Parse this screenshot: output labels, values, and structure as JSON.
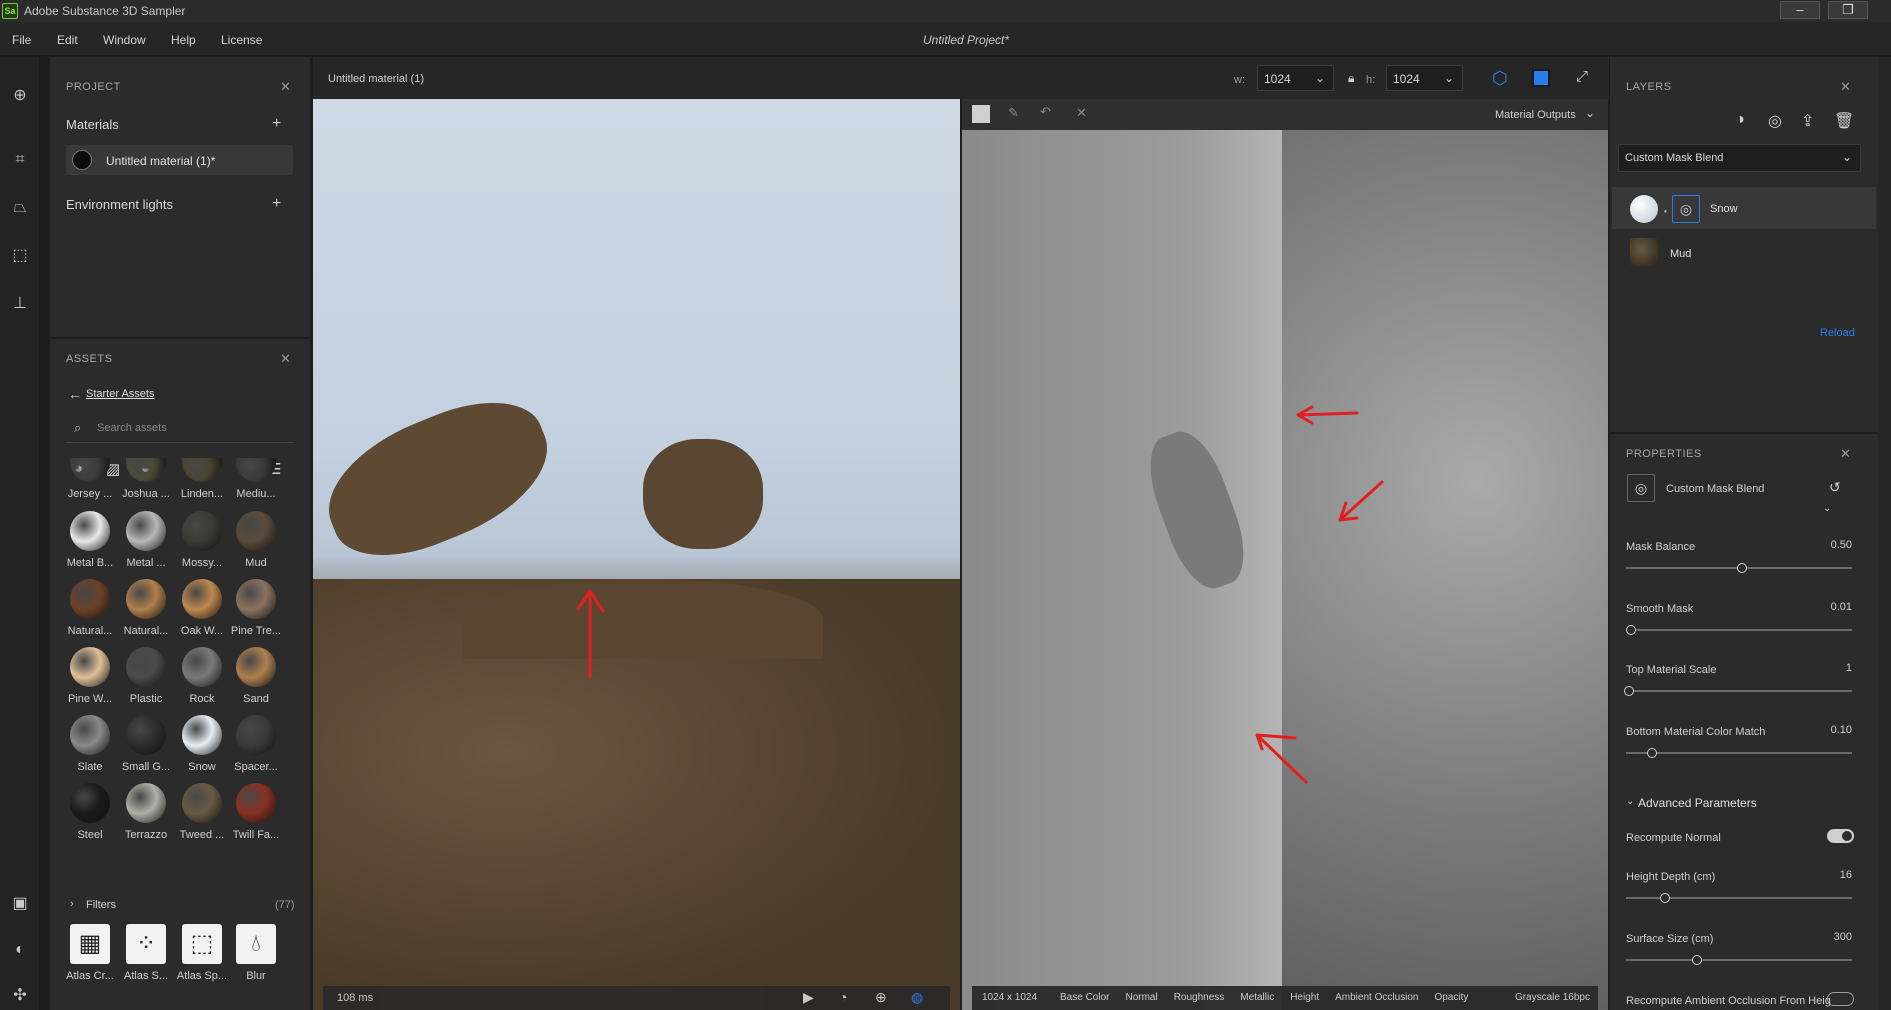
{
  "titlebar": {
    "logo_text": "Sa",
    "title": "Adobe Substance 3D Sampler"
  },
  "window_controls": {
    "minimize": "–",
    "maximize": "❐"
  },
  "menu": [
    "File",
    "Edit",
    "Window",
    "Help",
    "License"
  ],
  "project_title": "Untitled Project*",
  "project_panel": {
    "header": "PROJECT",
    "materials_label": "Materials",
    "material_item": "Untitled material (1)*",
    "env_lights_label": "Environment lights"
  },
  "assets_panel": {
    "header": "ASSETS",
    "breadcrumb": "Starter Assets",
    "search_placeholder": "Search assets",
    "materials": [
      {
        "label": "Jersey ...",
        "color": "#3c3c3c"
      },
      {
        "label": "Joshua ...",
        "color": "#4a4a3a"
      },
      {
        "label": "Linden...",
        "color": "#4a4530"
      },
      {
        "label": "Mediu...",
        "color": "#3a3a3a"
      },
      {
        "label": "Metal B...",
        "color": "#e8e8e8"
      },
      {
        "label": "Metal ...",
        "color": "#b8b8b8"
      },
      {
        "label": "Mossy...",
        "color": "#3a3a36"
      },
      {
        "label": "Mud",
        "color": "#5a4a38"
      },
      {
        "label": "Natural...",
        "color": "#6a4228"
      },
      {
        "label": "Natural...",
        "color": "#b0804a"
      },
      {
        "label": "Oak W...",
        "color": "#c0884e"
      },
      {
        "label": "Pine Tre...",
        "color": "#8a7360"
      },
      {
        "label": "Pine W...",
        "color": "#e0c098"
      },
      {
        "label": "Plastic",
        "color": "#4a4a4a"
      },
      {
        "label": "Rock",
        "color": "#7a7a7a"
      },
      {
        "label": "Sand",
        "color": "#b08050"
      },
      {
        "label": "Slate",
        "color": "#8a8a8a"
      },
      {
        "label": "Small G...",
        "color": "#2c2c2c"
      },
      {
        "label": "Snow",
        "color": "#e8eef4"
      },
      {
        "label": "Spacer...",
        "color": "#3a3a3a"
      },
      {
        "label": "Steel",
        "color": "#1a1a1a"
      },
      {
        "label": "Terrazzo",
        "color": "#b0b0a8"
      },
      {
        "label": "Tweed ...",
        "color": "#6a5a44"
      },
      {
        "label": "Twill Fa...",
        "color": "#8a3020"
      }
    ],
    "filters_label": "Filters",
    "filters_count": "(77)",
    "filters": [
      {
        "label": "Atlas Cr..."
      },
      {
        "label": "Atlas S..."
      },
      {
        "label": "Atlas Sp..."
      },
      {
        "label": "Blur"
      }
    ]
  },
  "viewport": {
    "material_name": "Untitled material (1)",
    "w_label": "w:",
    "w_value": "1024",
    "h_label": "h:",
    "h_value": "1024",
    "outputs_label": "Material Outputs",
    "render_time": "108 ms",
    "resolution": "1024 x 1024",
    "channels": [
      "Base Color",
      "Normal",
      "Roughness",
      "Metallic",
      "Height",
      "Ambient Occlusion",
      "Opacity"
    ],
    "grayscale": "Grayscale 16bpc"
  },
  "layers_panel": {
    "header": "LAYERS",
    "blend_mode": "Custom Mask Blend",
    "layers": [
      {
        "name": "Snow",
        "color": "#dfe8f0"
      },
      {
        "name": "Mud",
        "color": "#4a3a2a"
      }
    ],
    "reload": "Reload"
  },
  "properties_panel": {
    "header": "PROPERTIES",
    "filter_name": "Custom Mask Blend",
    "params": [
      {
        "label": "Mask Balance",
        "value": "0.50",
        "fraction": 0.5
      },
      {
        "label": "Smooth Mask",
        "value": "0.01",
        "fraction": 0.01
      },
      {
        "label": "Top Material Scale",
        "value": "1",
        "fraction": 0.0
      },
      {
        "label": "Bottom Material Color Match",
        "value": "0.10",
        "fraction": 0.1
      }
    ],
    "advanced_label": "Advanced Parameters",
    "recompute_normal": "Recompute Normal",
    "advanced_params": [
      {
        "label": "Height Depth (cm)",
        "value": "16",
        "fraction": 0.16
      },
      {
        "label": "Surface Size (cm)",
        "value": "300",
        "fraction": 0.3
      }
    ],
    "recompute_ao": "Recompute Ambient Occlusion From Heig"
  },
  "colors": {
    "accent": "#2680eb",
    "annotation": "#e02020"
  }
}
